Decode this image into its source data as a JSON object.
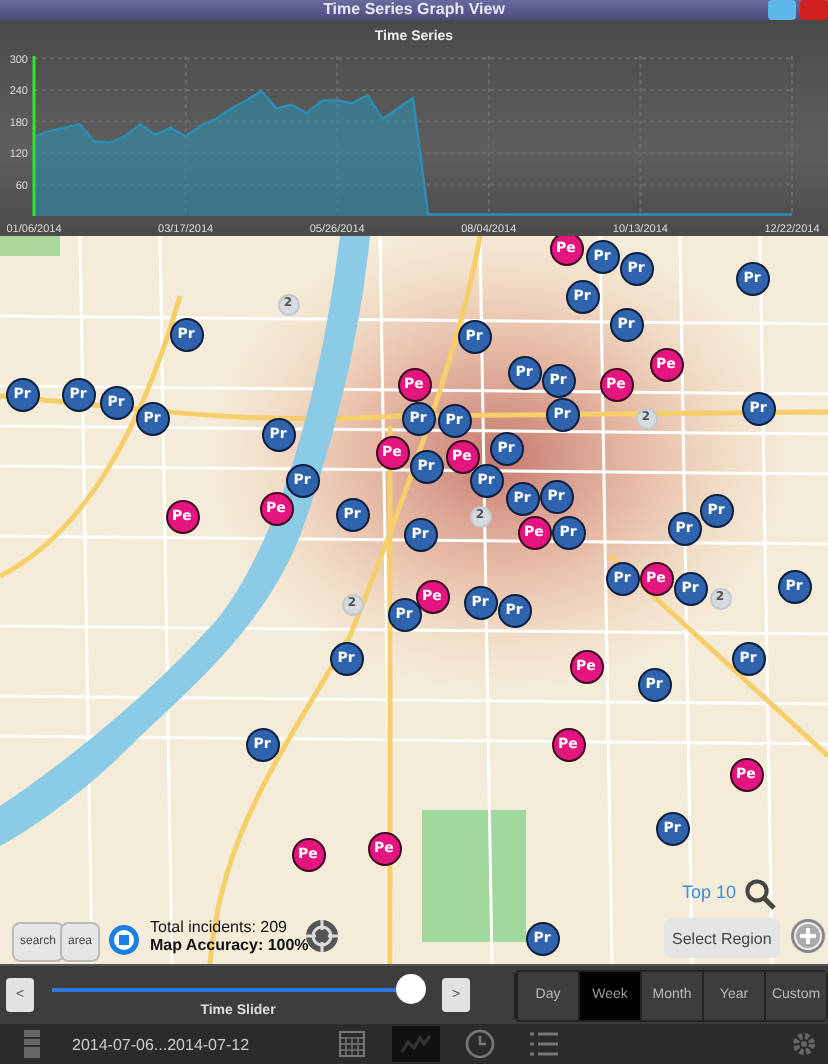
{
  "window": {
    "title": "Time Series Graph View"
  },
  "chart": {
    "chart_data": {
      "type": "area",
      "title": "Time Series",
      "categories": [
        "01/06/2014",
        null,
        null,
        null,
        null,
        null,
        null,
        null,
        null,
        null,
        "03/17/2014",
        null,
        null,
        null,
        null,
        null,
        null,
        null,
        null,
        null,
        "05/26/2014",
        null,
        null,
        null,
        null,
        null,
        null,
        null,
        null,
        null,
        "08/04/2014",
        null,
        null,
        null,
        null,
        null,
        null,
        null,
        null,
        null,
        "10/13/2014",
        null,
        null,
        null,
        null,
        null,
        null,
        null,
        null,
        null,
        "12/22/2014"
      ],
      "series": [
        {
          "color": "#2a8fb5",
          "values": [
            151,
            162,
            168,
            175,
            142,
            140,
            152,
            175,
            155,
            168,
            152,
            172,
            185,
            205,
            220,
            238,
            205,
            212,
            196,
            220,
            220,
            215,
            230,
            185,
            205,
            225,
            3,
            3,
            3,
            3,
            3,
            3,
            3,
            3,
            3,
            3,
            3,
            3,
            3,
            3,
            3,
            3,
            3,
            3,
            3,
            3,
            3,
            3,
            3,
            3,
            3
          ]
        }
      ],
      "ylim": [
        0,
        305
      ],
      "grid": true,
      "yticks": [
        60,
        120,
        180,
        240,
        300
      ]
    }
  },
  "map": {
    "pins": [
      {
        "label": "Pe",
        "kind": "person"
      },
      {
        "label": "Pr",
        "kind": "property"
      },
      {
        "label": "Pr",
        "kind": "property"
      },
      {
        "label": "Pr",
        "kind": "property"
      },
      {
        "label": "2",
        "kind": "cluster"
      },
      {
        "label": "Pr",
        "kind": "property"
      },
      {
        "label": "Pr",
        "kind": "property"
      },
      {
        "label": "Pr",
        "kind": "property"
      },
      {
        "label": "Pr",
        "kind": "property"
      },
      {
        "label": "Pe",
        "kind": "person"
      },
      {
        "label": "Pe",
        "kind": "person"
      },
      {
        "label": "Pr",
        "kind": "property"
      },
      {
        "label": "Pr",
        "kind": "property"
      },
      {
        "label": "Pe",
        "kind": "person"
      },
      {
        "label": "Pr",
        "kind": "property"
      },
      {
        "label": "Pr",
        "kind": "property"
      },
      {
        "label": "Pr",
        "kind": "property"
      },
      {
        "label": "Pr",
        "kind": "property"
      },
      {
        "label": "Pr",
        "kind": "property"
      },
      {
        "label": "Pr",
        "kind": "property"
      },
      {
        "label": "Pr",
        "kind": "property"
      },
      {
        "label": "Pr",
        "kind": "property"
      },
      {
        "label": "2",
        "kind": "cluster"
      },
      {
        "label": "Pr",
        "kind": "property"
      },
      {
        "label": "Pe",
        "kind": "person"
      },
      {
        "label": "Pe",
        "kind": "person"
      },
      {
        "label": "Pr",
        "kind": "property"
      },
      {
        "label": "Pr",
        "kind": "property"
      },
      {
        "label": "Pr",
        "kind": "property"
      },
      {
        "label": "Pr",
        "kind": "property"
      },
      {
        "label": "Pr",
        "kind": "property"
      },
      {
        "label": "Pr",
        "kind": "property"
      },
      {
        "label": "Pe",
        "kind": "person"
      },
      {
        "label": "Pe",
        "kind": "person"
      },
      {
        "label": "Pr",
        "kind": "property"
      },
      {
        "label": "2",
        "kind": "cluster"
      },
      {
        "label": "Pr",
        "kind": "property"
      },
      {
        "label": "Pr",
        "kind": "property"
      },
      {
        "label": "Pe",
        "kind": "person"
      },
      {
        "label": "Pr",
        "kind": "property"
      },
      {
        "label": "Pr",
        "kind": "property"
      },
      {
        "label": "Pr",
        "kind": "property"
      },
      {
        "label": "Pe",
        "kind": "person"
      },
      {
        "label": "Pr",
        "kind": "property"
      },
      {
        "label": "Pr",
        "kind": "property"
      },
      {
        "label": "2",
        "kind": "cluster"
      },
      {
        "label": "Pe",
        "kind": "person"
      },
      {
        "label": "Pr",
        "kind": "property"
      },
      {
        "label": "2",
        "kind": "cluster"
      },
      {
        "label": "Pr",
        "kind": "property"
      },
      {
        "label": "Pr",
        "kind": "property"
      },
      {
        "label": "Pr",
        "kind": "property"
      },
      {
        "label": "Pr",
        "kind": "property"
      },
      {
        "label": "Pe",
        "kind": "person"
      },
      {
        "label": "Pr",
        "kind": "property"
      },
      {
        "label": "Pe",
        "kind": "person"
      },
      {
        "label": "Pr",
        "kind": "property"
      },
      {
        "label": "Pe",
        "kind": "person"
      },
      {
        "label": "Pr",
        "kind": "property"
      },
      {
        "label": "Pe",
        "kind": "person"
      },
      {
        "label": "Pe",
        "kind": "person"
      },
      {
        "label": "Pr",
        "kind": "property"
      }
    ],
    "search_button": "search",
    "area_button": "area",
    "total_incidents": "Total incidents: 209",
    "map_accuracy": "Map Accuracy: 100%",
    "top_link": "Top 10",
    "select_region_button": "Select Region"
  },
  "controls": {
    "prev": "<",
    "next": ">",
    "slider": {
      "label": "Time Slider",
      "level": 0.96
    },
    "ranges": [
      {
        "label": "Day",
        "selected": false
      },
      {
        "label": "Week",
        "selected": true
      },
      {
        "label": "Month",
        "selected": false
      },
      {
        "label": "Year",
        "selected": false
      },
      {
        "label": "Custom",
        "selected": false
      }
    ]
  },
  "toolbar": {
    "date_range": "2014-07-06...2014-07-12",
    "tabs": [
      {
        "kind": "calendar",
        "selected": false
      },
      {
        "kind": "chart",
        "selected": true
      },
      {
        "kind": "clock",
        "selected": false
      },
      {
        "kind": "list",
        "selected": false
      }
    ]
  }
}
